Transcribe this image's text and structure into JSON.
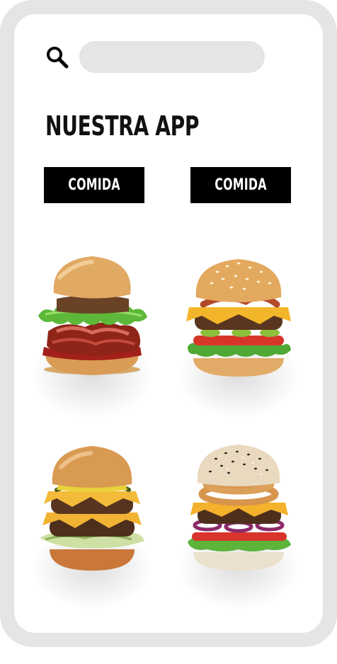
{
  "search": {
    "placeholder": "",
    "value": ""
  },
  "header": {
    "title": "NUESTRA APP"
  },
  "categories": [
    {
      "label": "COMIDA"
    },
    {
      "label": "COMIDA"
    }
  ],
  "products": [
    {
      "icon": "burger-bacon-image"
    },
    {
      "icon": "burger-sesame-cheese-image"
    },
    {
      "icon": "burger-double-cheese-image"
    },
    {
      "icon": "burger-onion-ring-image"
    }
  ],
  "colors": {
    "frame": "#e6e4e5",
    "screen": "#ffffff",
    "button": "#000000",
    "button_text": "#ffffff",
    "title": "#111111",
    "search_bar": "#e6e4e5"
  }
}
